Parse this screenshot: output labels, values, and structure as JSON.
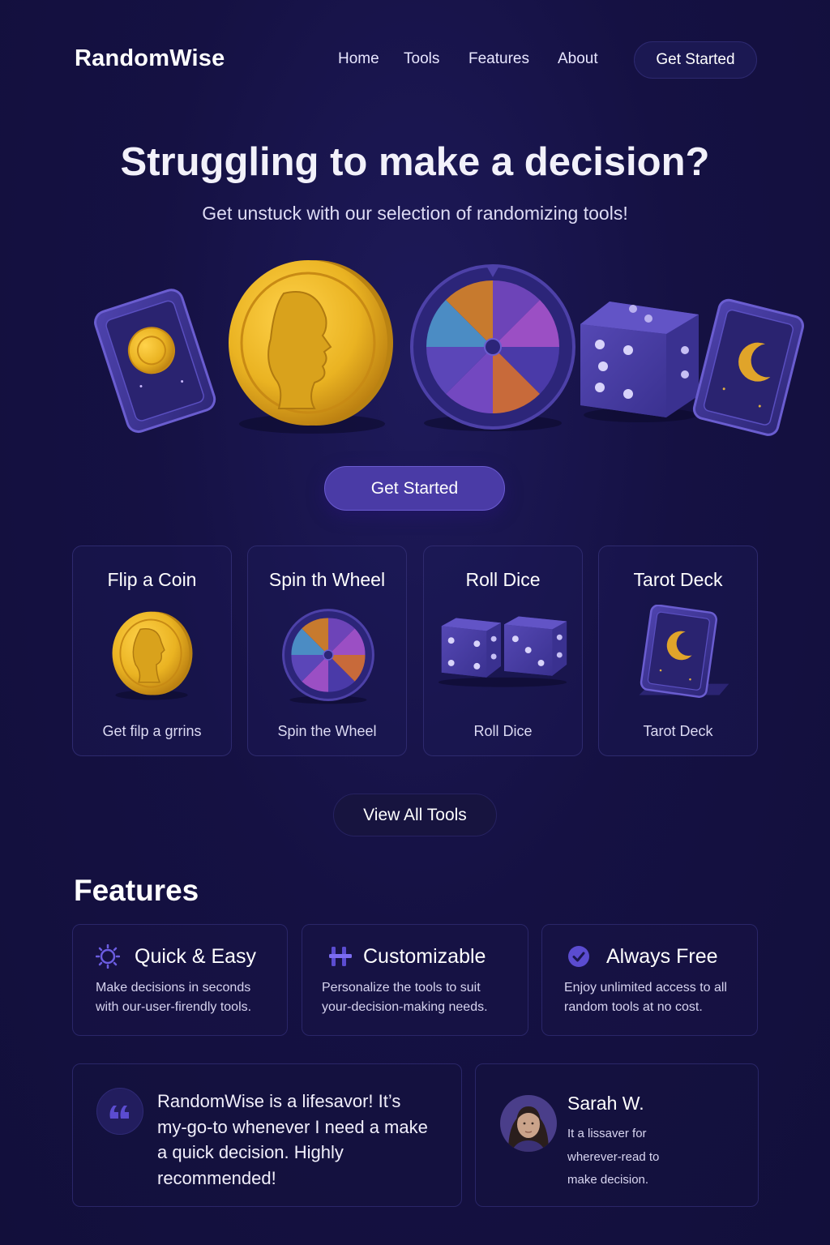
{
  "nav": {
    "brand": "RandomWise",
    "links": [
      "Home",
      "Tools",
      "Features",
      "About"
    ],
    "cta": "Get Started"
  },
  "hero": {
    "title": "Struggling to make a decision?",
    "subtitle": "Get unstuck with our selection of randomizing tools!",
    "cta": "Get Started",
    "art_icons": [
      "tarot-card-coin-icon",
      "gold-coin-icon",
      "prize-wheel-icon",
      "die-icon",
      "tarot-card-moon-icon"
    ]
  },
  "tools": [
    {
      "title": "Flip a Coin",
      "caption": "Get filp a grrins",
      "icon": "coin-icon"
    },
    {
      "title": "Spin th Wheel",
      "caption": "Spin the Wheel",
      "icon": "wheel-icon"
    },
    {
      "title": "Roll Dice",
      "caption": "Roll Dice",
      "icon": "dice-icon"
    },
    {
      "title": "Tarot Deck",
      "caption": "Tarot Deck",
      "icon": "tarot-card-icon"
    }
  ],
  "view_all": "View All Tools",
  "features": {
    "heading": "Features",
    "items": [
      {
        "title": "Quick & Easy",
        "line1": "Make decisions in seconds",
        "line2": "with our-user-firendly tools.",
        "icon": "sun-gear-icon"
      },
      {
        "title": "Customizable",
        "line1": "Personalize the tools to suit",
        "line2": "your-decision-making needs.",
        "icon": "sliders-icon"
      },
      {
        "title": "Always Free",
        "line1": "Enjoy unlimited access to all",
        "line2": "random tools at no cost.",
        "icon": "check-circle-icon"
      }
    ]
  },
  "testimonial": {
    "quote_lines": [
      "RandomWise is a lifesavor! It’s",
      "my-go-to whenever I need a make",
      "a quick decision. Highly",
      "recommended!"
    ],
    "name": "Sarah W.",
    "body_lines": [
      "It a lissaver for",
      "wherever-read to",
      "make decision."
    ]
  },
  "colors": {
    "background": "#151143",
    "accent": "#4a3ba6",
    "gold": "#e8b020",
    "card_purple": "#3f3596"
  }
}
